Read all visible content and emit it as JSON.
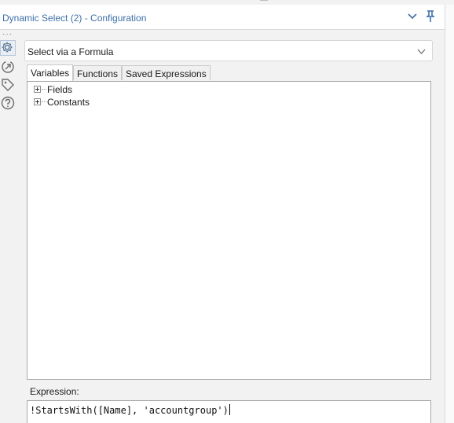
{
  "window": {
    "title": "Dynamic Select (2) - Configuration"
  },
  "sidebar": {
    "icons": [
      "gear-icon",
      "annotation-icon",
      "tag-icon",
      "help-icon"
    ]
  },
  "mode_select": {
    "selected": "Select via a Formula"
  },
  "tabs": [
    {
      "label": "Variables",
      "active": true
    },
    {
      "label": "Functions",
      "active": false
    },
    {
      "label": "Saved Expressions",
      "active": false
    }
  ],
  "tree": {
    "items": [
      {
        "label": "Fields"
      },
      {
        "label": "Constants"
      }
    ]
  },
  "expression": {
    "label": "Expression:",
    "value": "!StartsWith([Name], 'accountgroup')"
  },
  "colors": {
    "title_blue": "#3d6fa6",
    "panel_border": "#a8a8a8"
  }
}
